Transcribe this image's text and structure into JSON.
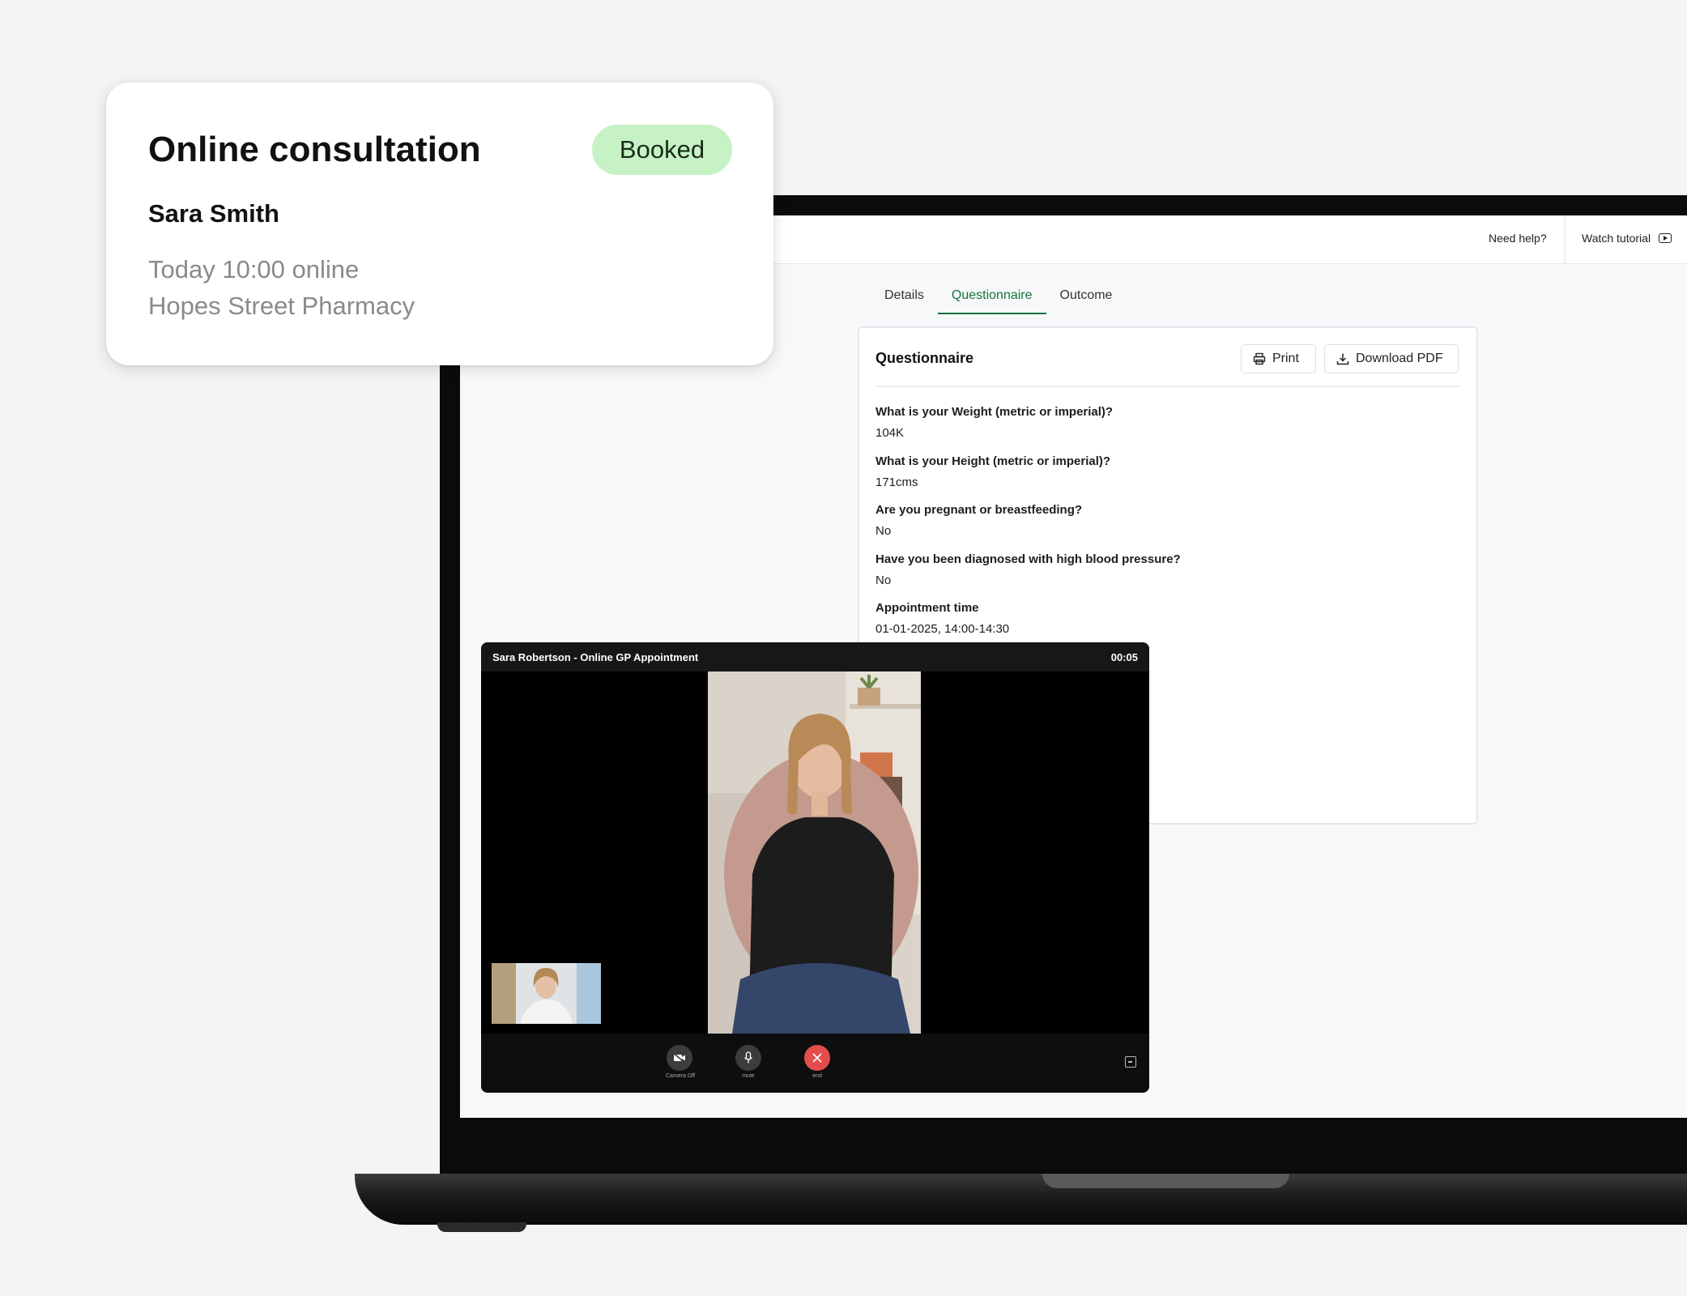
{
  "booking": {
    "title": "Online consultation",
    "status": "Booked",
    "patient_name": "Sara Smith",
    "time": "Today 10:00 online",
    "location": "Hopes Street Pharmacy",
    "status_color": "#c6f2c5"
  },
  "topbar": {
    "need_help": "Need help?",
    "watch_tutorial": "Watch tutorial",
    "watch_tutorial_icon": "youtube-icon"
  },
  "tabs": [
    {
      "label": "Details",
      "active": false
    },
    {
      "label": "Questionnaire",
      "active": true
    },
    {
      "label": "Outcome",
      "active": false
    }
  ],
  "accent_color": "#13733d",
  "questionnaire": {
    "title": "Questionnaire",
    "print_label": "Print",
    "print_icon": "printer-icon",
    "download_label": "Download PDF",
    "download_icon": "download-icon",
    "items": [
      {
        "question": "What is your Weight (metric or imperial)?",
        "answer": "104K"
      },
      {
        "question": "What is your Height (metric or imperial)?",
        "answer": "171cms"
      },
      {
        "question": "Are you pregnant or breastfeeding?",
        "answer": "No"
      },
      {
        "question": "Have you been diagnosed with high blood pressure?",
        "answer": "No"
      },
      {
        "question": "Appointment time",
        "answer": "01-01-2025, 14:00-14:30"
      }
    ]
  },
  "video_call": {
    "title": "Sara Robertson - Online GP Appointment",
    "timer": "00:05",
    "controls": [
      {
        "label": "Camera Off",
        "icon": "camera-off-icon"
      },
      {
        "label": "mute",
        "icon": "microphone-icon"
      },
      {
        "label": "end",
        "icon": "close-icon"
      }
    ],
    "end_color": "#e44d4d"
  }
}
